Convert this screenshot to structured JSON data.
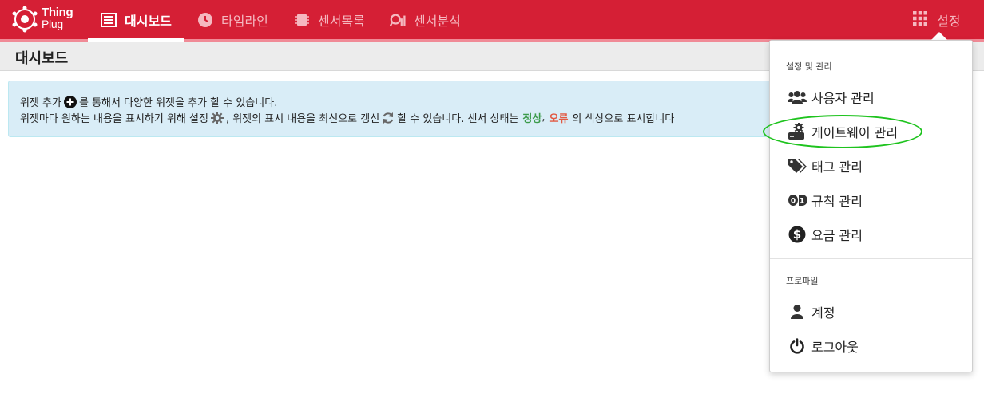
{
  "app": {
    "logo_line1": "Thing",
    "logo_line2": "Plug"
  },
  "nav": {
    "items": [
      {
        "label": "대시보드",
        "icon": "dashboard-icon",
        "active": true
      },
      {
        "label": "타임라인",
        "icon": "clock-icon",
        "active": false
      },
      {
        "label": "센서목록",
        "icon": "chip-icon",
        "active": false
      },
      {
        "label": "센서분석",
        "icon": "analysis-icon",
        "active": false
      }
    ],
    "settings_label": "설정"
  },
  "page": {
    "title": "대시보드"
  },
  "info": {
    "line1_a": "위젯 추가",
    "line1_b": "를 통해서 다양한 위젯을 추가 할 수 있습니다.",
    "line2_a": "위젯마다 원하는 내용을 표시하기 위해 설정",
    "line2_b": ", 위젯의 표시 내용을 최신으로 갱신",
    "line2_c": "할 수 있습니다. 센서 상태는",
    "status_ok": "정상",
    "comma": ",",
    "status_err": "오류",
    "line2_d": "의 색상으로 표시합니다"
  },
  "dropdown": {
    "section1_header": "설정 및 관리",
    "section1_items": [
      {
        "label": "사용자 관리",
        "icon": "users-icon"
      },
      {
        "label": "게이트웨이 관리",
        "icon": "gateway-icon"
      },
      {
        "label": "태그 관리",
        "icon": "tags-icon"
      },
      {
        "label": "규칙 관리",
        "icon": "rule-icon"
      },
      {
        "label": "요금 관리",
        "icon": "dollar-icon"
      }
    ],
    "section2_header": "프로파일",
    "section2_items": [
      {
        "label": "계정",
        "icon": "user-icon"
      },
      {
        "label": "로그아웃",
        "icon": "power-icon"
      }
    ]
  },
  "colors": {
    "brand": "#d51f35",
    "ok": "#3c9b4b",
    "error": "#e25a44",
    "highlight": "#1ec31e",
    "info_bg": "#d9edf7"
  }
}
